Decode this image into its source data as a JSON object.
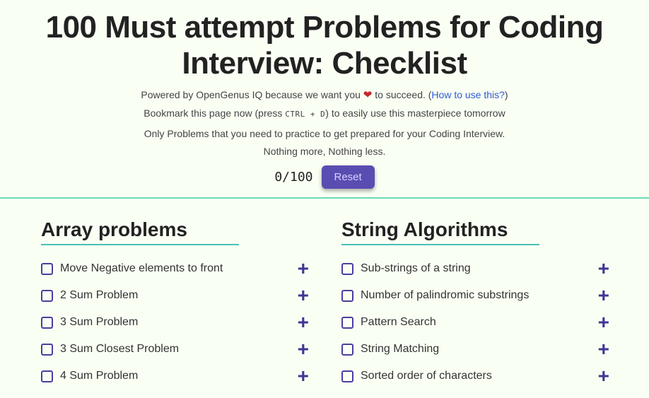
{
  "title": "100 Must attempt Problems for Coding Interview: Checklist",
  "subline1_a": "Powered by OpenGenus IQ because we want you ",
  "subline1_b": " to succeed. (",
  "how_link": "How to use this?",
  "subline1_c": ")",
  "subline2_a": "Bookmark this page now (press ",
  "kbd": "CTRL + D",
  "subline2_b": ") to easily use this masterpiece tomorrow",
  "subline3": "Only Problems that you need to practice to get prepared for your Coding Interview.",
  "subline4": "Nothing more, Nothing less.",
  "counter": "0/100",
  "reset": "Reset",
  "sections": {
    "left": {
      "heading": "Array problems",
      "items": [
        "Move Negative elements to front",
        "2 Sum Problem",
        "3 Sum Problem",
        "3 Sum Closest Problem",
        "4 Sum Problem"
      ]
    },
    "right": {
      "heading": "String Algorithms",
      "items": [
        "Sub-strings of a string",
        "Number of palindromic substrings",
        "Pattern Search",
        "String Matching",
        "Sorted order of characters"
      ]
    }
  }
}
